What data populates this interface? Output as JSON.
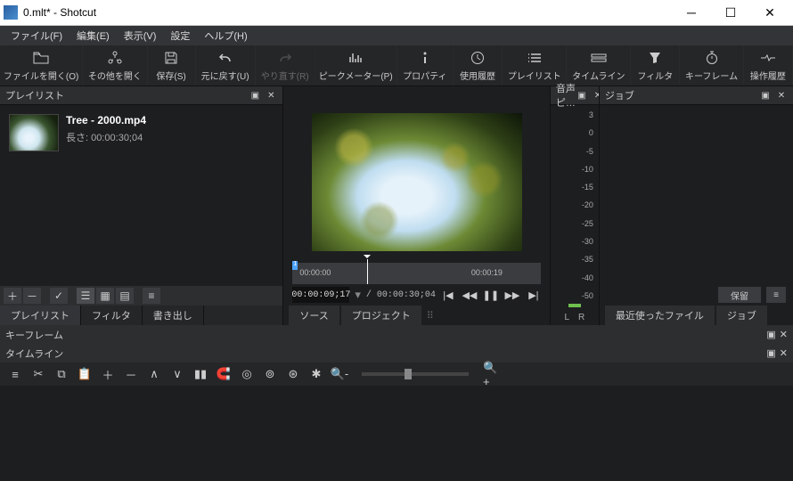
{
  "window": {
    "title": "0.mlt* - Shotcut"
  },
  "menu": {
    "file": "ファイル(F)",
    "edit": "編集(E)",
    "view": "表示(V)",
    "settings": "設定",
    "help": "ヘルプ(H)"
  },
  "toolbar": {
    "open_file": "ファイルを開く(O)",
    "open_other": "その他を開く",
    "save": "保存(S)",
    "undo": "元に戻す(U)",
    "redo": "やり直す(R)",
    "peak_meter": "ピークメーター(P)",
    "properties": "プロパティ",
    "recent": "使用履歴",
    "playlist": "プレイリスト",
    "timeline": "タイムライン",
    "filters": "フィルタ",
    "keyframes": "キーフレーム",
    "history": "操作履歴"
  },
  "panels": {
    "playlist_title": "プレイリスト",
    "audio_meter_title": "音声ピ…",
    "jobs_title": "ジョブ",
    "keyframes_title": "キーフレーム",
    "timeline_title": "タイムライン"
  },
  "playlist": {
    "item_name": "Tree - 2000.mp4",
    "item_len_label": "長さ: 00:00:30;04"
  },
  "left_tabs": {
    "playlist": "プレイリスト",
    "filters": "フィルタ",
    "export": "書き出し"
  },
  "scrub": {
    "marker": "1",
    "tick0": "00:00:00",
    "tick1": "00:00:19"
  },
  "transport": {
    "current": "00:00:09;17",
    "sep": "/",
    "total": "00:00:30;04"
  },
  "center_tabs": {
    "source": "ソース",
    "project": "プロジェクト"
  },
  "meter": {
    "scale": [
      "3",
      "0",
      "-5",
      "-10",
      "-15",
      "-20",
      "-25",
      "-30",
      "-35",
      "-40",
      "-50"
    ],
    "L": "L",
    "R": "R"
  },
  "jobs": {
    "hold": "保留",
    "recent_tab": "最近使ったファイル",
    "jobs_tab": "ジョブ"
  }
}
